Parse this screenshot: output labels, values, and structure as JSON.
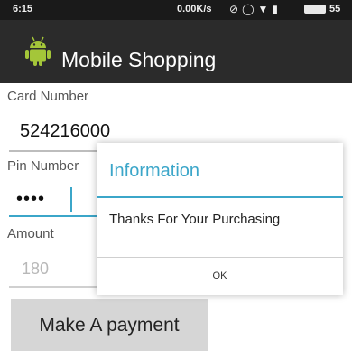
{
  "status_bar": {
    "time": "6:15",
    "net_speed": "0.00K/s",
    "battery": "55",
    "icons": [
      "mute-icon",
      "alarm-icon",
      "wifi-icon",
      "signal-icon",
      "battery-icon"
    ]
  },
  "action_bar": {
    "title": "Mobile Shopping",
    "icon": "android-icon"
  },
  "form": {
    "card_number_label": "Card Number",
    "card_number_value": "524216000",
    "pin_label": "Pin Number",
    "pin_value": "••••",
    "amount_label": "Amount",
    "amount_hint": "180",
    "payment_button": "Make A payment"
  },
  "dialog": {
    "title": "Information",
    "message": "Thanks For Your Purchasing",
    "ok_label": "OK"
  },
  "colors": {
    "accent": "#3ba6c9",
    "action_bar": "#2b2b2b",
    "status_bar": "#1a1a1a",
    "android_green": "#a4c639"
  }
}
